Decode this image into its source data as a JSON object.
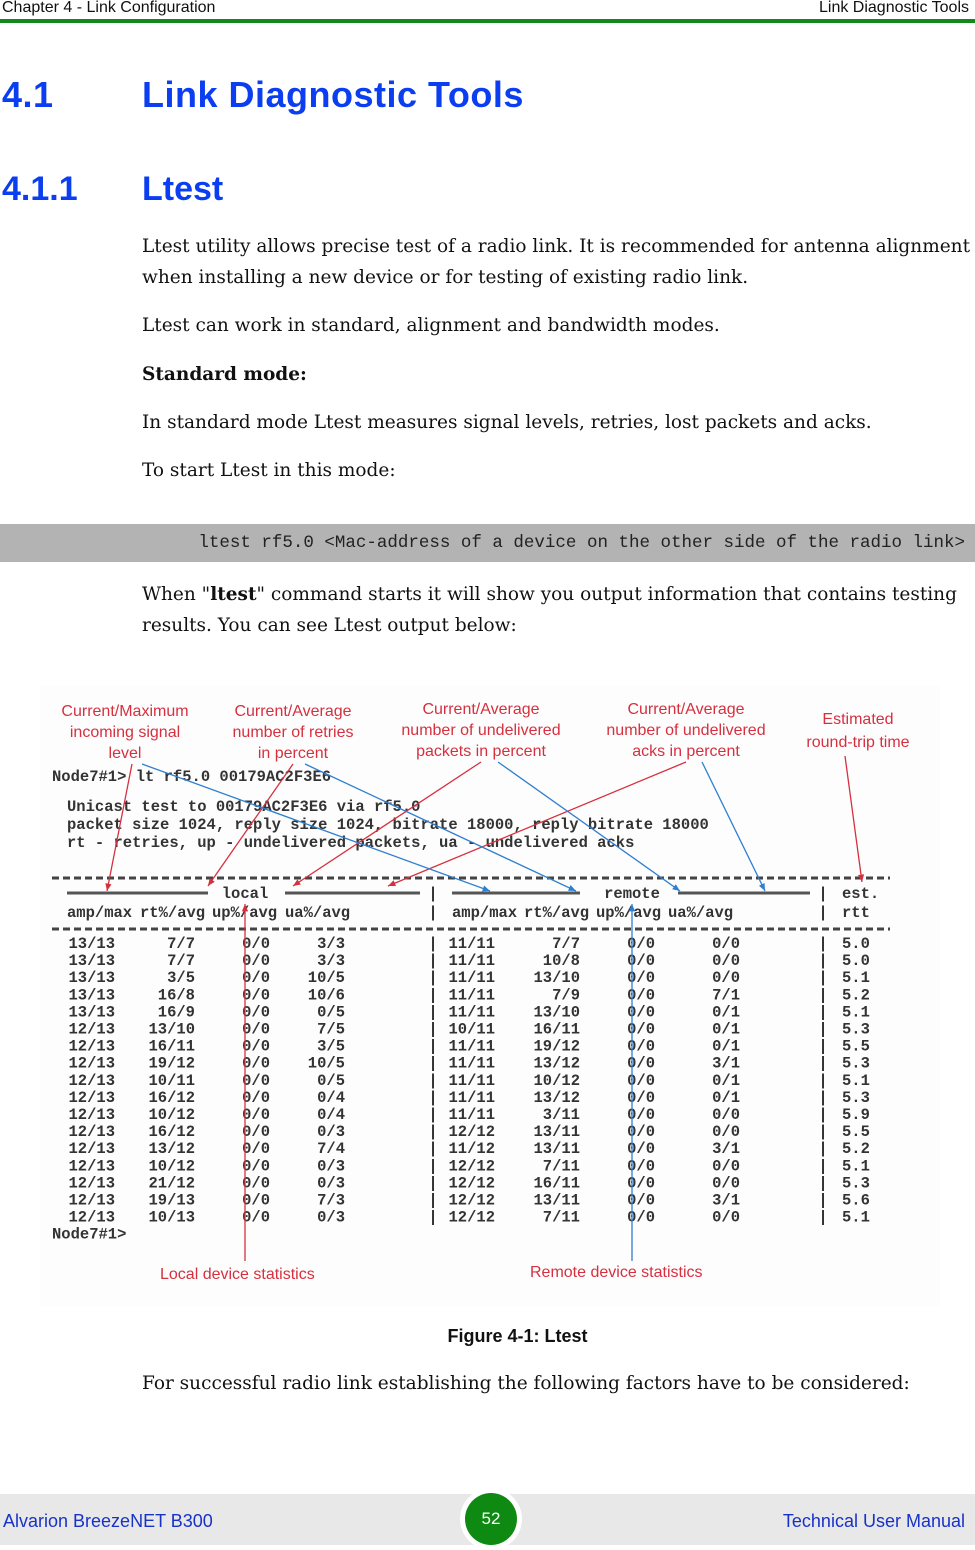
{
  "header": {
    "chapter": "Chapter 4 - Link Configuration",
    "section": "Link Diagnostic Tools",
    "rule_color": "#12891a"
  },
  "heading1": {
    "number": "4.1",
    "title": "Link Diagnostic Tools"
  },
  "heading2": {
    "number": "4.1.1",
    "title": "Ltest"
  },
  "paragraphs": {
    "intro": "Ltest utility allows precise test of a radio link. It is recommended for antenna alignment when installing a new device or for testing of existing radio link.",
    "modes": "Ltest can work in standard, alignment and bandwidth modes.",
    "standard_heading": "Standard mode:",
    "standard_desc": "In standard mode Ltest measures signal levels, retries, lost packets and acks.",
    "start": "To start Ltest in this mode:",
    "output_pre": "When \"",
    "output_cmd": "ltest",
    "output_post": "\" command starts it will show you output information that contains testing results. You can see Ltest output below:",
    "closing": "For successful radio link establishing the following factors have to be considered:"
  },
  "code_block": "ltest rf5.0 <Mac-address of a device on the other side of the radio link>",
  "figure": {
    "caption": "Figure 4-1: Ltest",
    "annotations": {
      "signal": [
        "Current/Maximum",
        "incoming signal",
        "level"
      ],
      "retries": [
        "Current/Average",
        "number of retries",
        "in percent"
      ],
      "packets": [
        "Current/Average",
        "number of undelivered",
        "packets in percent"
      ],
      "acks": [
        "Current/Average",
        "number of undelivered",
        "acks in percent"
      ],
      "rtt": [
        "Estimated",
        "round-trip time"
      ],
      "local": "Local device statistics",
      "remote": "Remote device statistics"
    },
    "terminal": {
      "prompt_cmd": "Node7#1> lt rf5.0 00179AC2F3E6",
      "info_lines": [
        "Unicast test to 00179AC2F3E6 via rf5.0",
        "packet size 1024, reply size 1024, bitrate 18000, reply bitrate 18000",
        "rt - retries, up - undelivered packets, ua - undelivered acks"
      ],
      "group_local": "local",
      "group_remote": "remote",
      "group_est": "est.",
      "columns": [
        "amp/max",
        "rt%/avg",
        "up%/avg",
        "ua%/avg",
        "amp/max",
        "rt%/avg",
        "up%/avg",
        "ua%/avg",
        "rtt"
      ],
      "rows": [
        [
          "13/13",
          "7/7",
          "0/0",
          "3/3",
          "11/11",
          "7/7",
          "0/0",
          "0/0",
          "5.0"
        ],
        [
          "13/13",
          "7/7",
          "0/0",
          "3/3",
          "11/11",
          "10/8",
          "0/0",
          "0/0",
          "5.0"
        ],
        [
          "13/13",
          "3/5",
          "0/0",
          "10/5",
          "11/11",
          "13/10",
          "0/0",
          "0/0",
          "5.1"
        ],
        [
          "13/13",
          "16/8",
          "0/0",
          "10/6",
          "11/11",
          "7/9",
          "0/0",
          "7/1",
          "5.2"
        ],
        [
          "13/13",
          "16/9",
          "0/0",
          "0/5",
          "11/11",
          "13/10",
          "0/0",
          "0/1",
          "5.1"
        ],
        [
          "12/13",
          "13/10",
          "0/0",
          "7/5",
          "10/11",
          "16/11",
          "0/0",
          "0/1",
          "5.3"
        ],
        [
          "12/13",
          "16/11",
          "0/0",
          "3/5",
          "11/11",
          "19/12",
          "0/0",
          "0/1",
          "5.5"
        ],
        [
          "12/13",
          "19/12",
          "0/0",
          "10/5",
          "11/11",
          "13/12",
          "0/0",
          "3/1",
          "5.3"
        ],
        [
          "12/13",
          "10/11",
          "0/0",
          "0/5",
          "11/11",
          "10/12",
          "0/0",
          "0/1",
          "5.1"
        ],
        [
          "12/13",
          "16/12",
          "0/0",
          "0/4",
          "11/11",
          "13/12",
          "0/0",
          "0/1",
          "5.3"
        ],
        [
          "12/13",
          "10/12",
          "0/0",
          "0/4",
          "11/11",
          "3/11",
          "0/0",
          "0/0",
          "5.9"
        ],
        [
          "12/13",
          "16/12",
          "0/0",
          "0/3",
          "12/12",
          "13/11",
          "0/0",
          "0/0",
          "5.5"
        ],
        [
          "12/13",
          "13/12",
          "0/0",
          "7/4",
          "11/12",
          "13/11",
          "0/0",
          "3/1",
          "5.2"
        ],
        [
          "12/13",
          "10/12",
          "0/0",
          "0/3",
          "12/12",
          "7/11",
          "0/0",
          "0/0",
          "5.1"
        ],
        [
          "12/13",
          "21/12",
          "0/0",
          "0/3",
          "12/12",
          "16/11",
          "0/0",
          "0/0",
          "5.3"
        ],
        [
          "12/13",
          "19/13",
          "0/0",
          "7/3",
          "12/12",
          "13/11",
          "0/0",
          "3/1",
          "5.6"
        ],
        [
          "12/13",
          "10/13",
          "0/0",
          "0/3",
          "12/12",
          "7/11",
          "0/0",
          "0/0",
          "5.1"
        ]
      ],
      "end_prompt": "Node7#1>"
    },
    "colors": {
      "annotation": "#d6303f",
      "local_arrow": "#d6303f",
      "remote_arrow": "#2f7fd0"
    }
  },
  "footer": {
    "product": "Alvarion BreezeNET B300",
    "page": "52",
    "doc": "Technical User Manual"
  }
}
